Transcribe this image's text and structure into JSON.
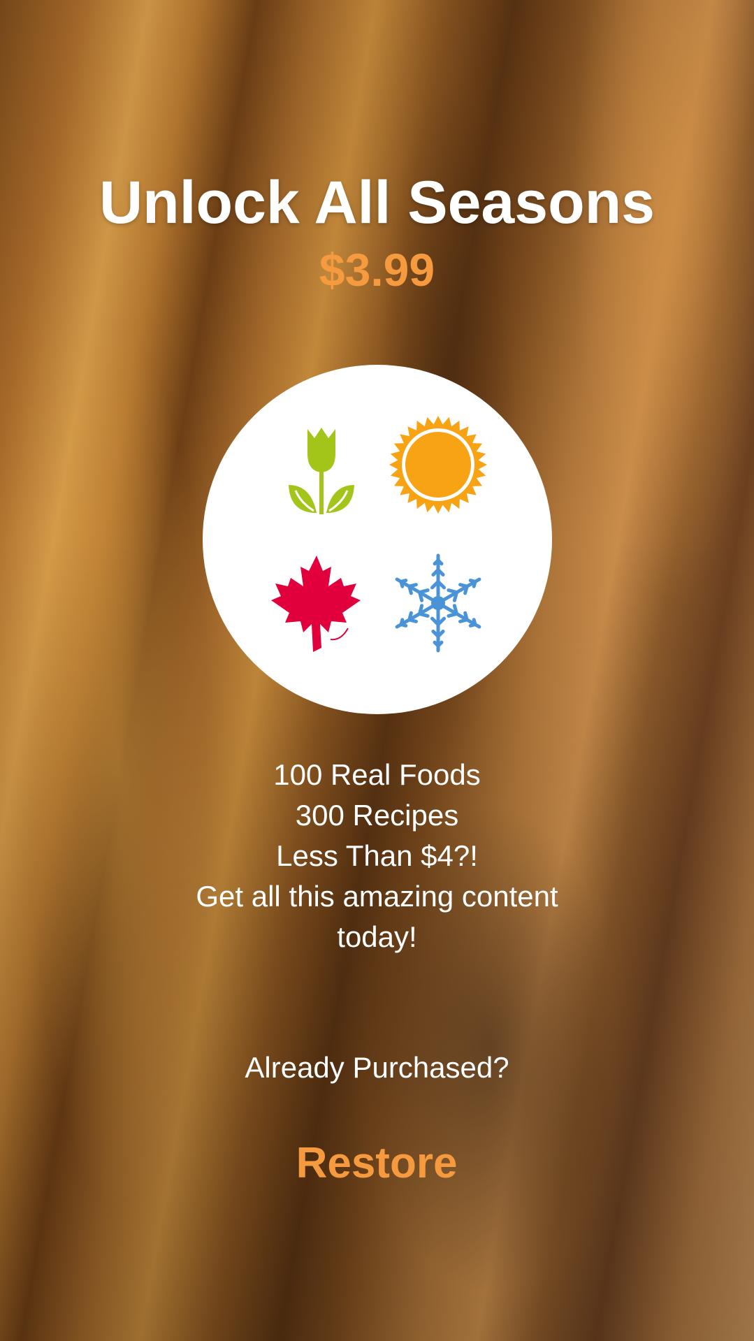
{
  "header": {
    "title": "Unlock All Seasons",
    "price": "$3.99"
  },
  "seasons": {
    "icons": [
      "spring-tulip-icon",
      "summer-sun-icon",
      "autumn-maple-leaf-icon",
      "winter-snowflake-icon"
    ],
    "colors": {
      "spring": "#a3c51a",
      "summer": "#f7a314",
      "autumn": "#e2003c",
      "winter": "#4a93d6"
    }
  },
  "features": {
    "lines": [
      "100 Real Foods",
      "300 Recipes",
      "Less Than $4?!",
      "Get all this amazing content",
      "today!"
    ]
  },
  "restore": {
    "prompt": "Already Purchased?",
    "button_label": "Restore"
  },
  "colors": {
    "accent": "#f59a3e",
    "text": "#ffffff"
  }
}
